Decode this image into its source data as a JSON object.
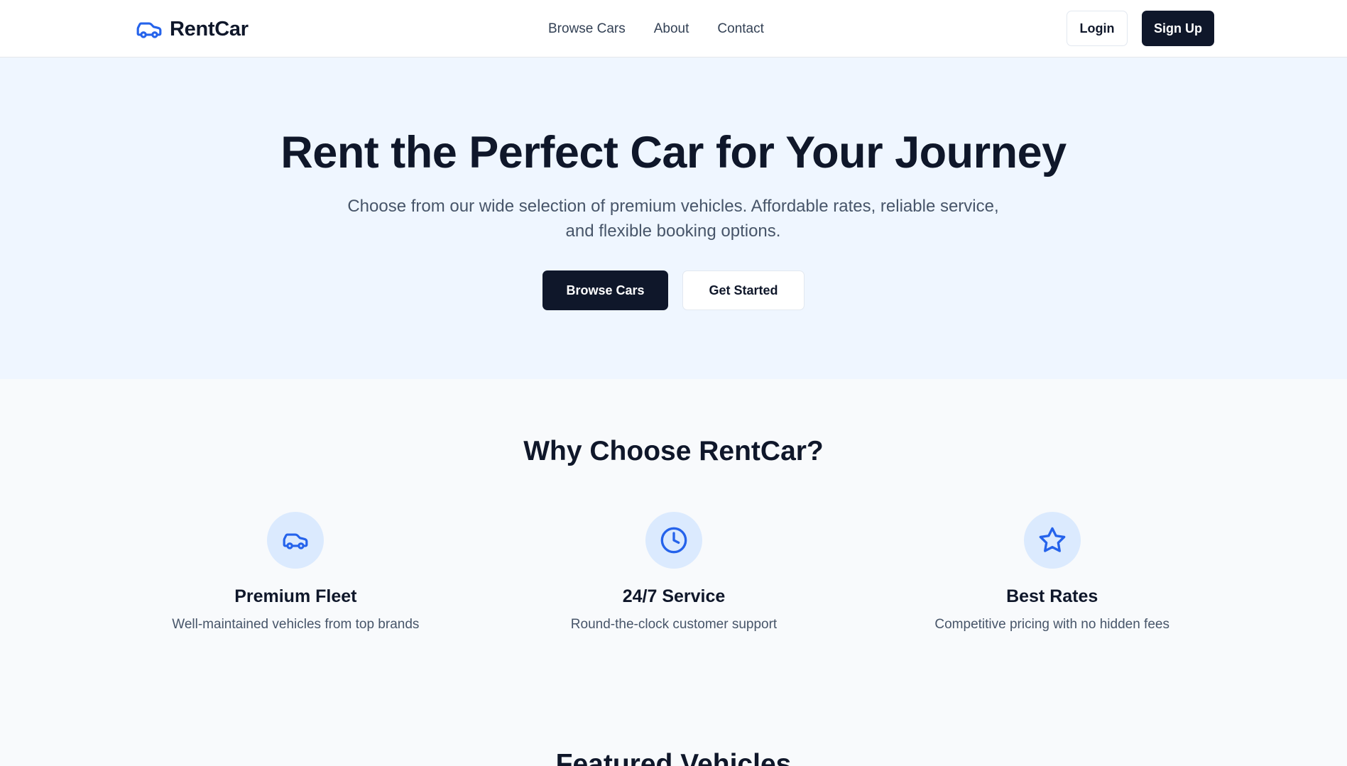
{
  "header": {
    "brand": "RentCar",
    "nav": [
      {
        "label": "Browse Cars"
      },
      {
        "label": "About"
      },
      {
        "label": "Contact"
      }
    ],
    "login_label": "Login",
    "signup_label": "Sign Up"
  },
  "hero": {
    "title": "Rent the Perfect Car for Your Journey",
    "subtitle_line1": "Choose from our wide selection of premium vehicles. Affordable rates, reliable service,",
    "subtitle_line2": "and flexible booking options.",
    "primary_label": "Browse Cars",
    "secondary_label": "Get Started"
  },
  "why": {
    "title": "Why Choose RentCar?",
    "features": [
      {
        "icon": "car-icon",
        "title": "Premium Fleet",
        "desc": "Well-maintained vehicles from top brands"
      },
      {
        "icon": "clock-icon",
        "title": "24/7 Service",
        "desc": "Round-the-clock customer support"
      },
      {
        "icon": "star-icon",
        "title": "Best Rates",
        "desc": "Competitive pricing with no hidden fees"
      }
    ]
  },
  "featured": {
    "title": "Featured Vehicles"
  },
  "colors": {
    "accent": "#2563eb",
    "dark": "#0f172a",
    "hero_bg": "#eff6ff",
    "icon_bg": "#dbeafe"
  }
}
